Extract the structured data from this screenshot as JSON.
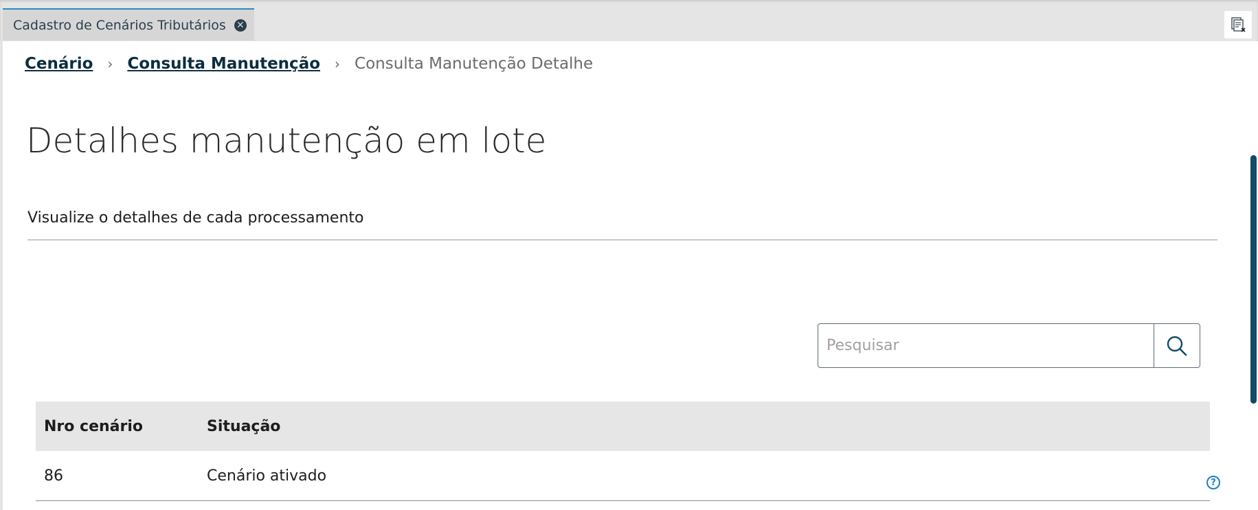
{
  "tab": {
    "title": "Cadastro de Cenários Tributários",
    "close_glyph": "✕"
  },
  "breadcrumb": {
    "items": [
      {
        "label": "Cenário"
      },
      {
        "label": "Consulta Manutenção"
      }
    ],
    "current": "Consulta Manutenção Detalhe",
    "separator": "›"
  },
  "page": {
    "title": "Detalhes manutenção em lote",
    "subtitle": "Visualize o detalhes de cada processamento"
  },
  "search": {
    "placeholder": "Pesquisar",
    "value": ""
  },
  "table": {
    "headers": [
      "Nro cenário",
      "Situação"
    ],
    "rows": [
      [
        "86",
        "Cenário ativado"
      ]
    ]
  },
  "help": {
    "glyph": "?"
  },
  "colors": {
    "accent": "#0f4a67",
    "tab_border": "#2a8bbb",
    "help": "#1b7fc1"
  },
  "icons": [
    "close-circle-icon",
    "close-all-tabs-icon",
    "chevron-right-icon",
    "search-icon",
    "help-icon"
  ]
}
